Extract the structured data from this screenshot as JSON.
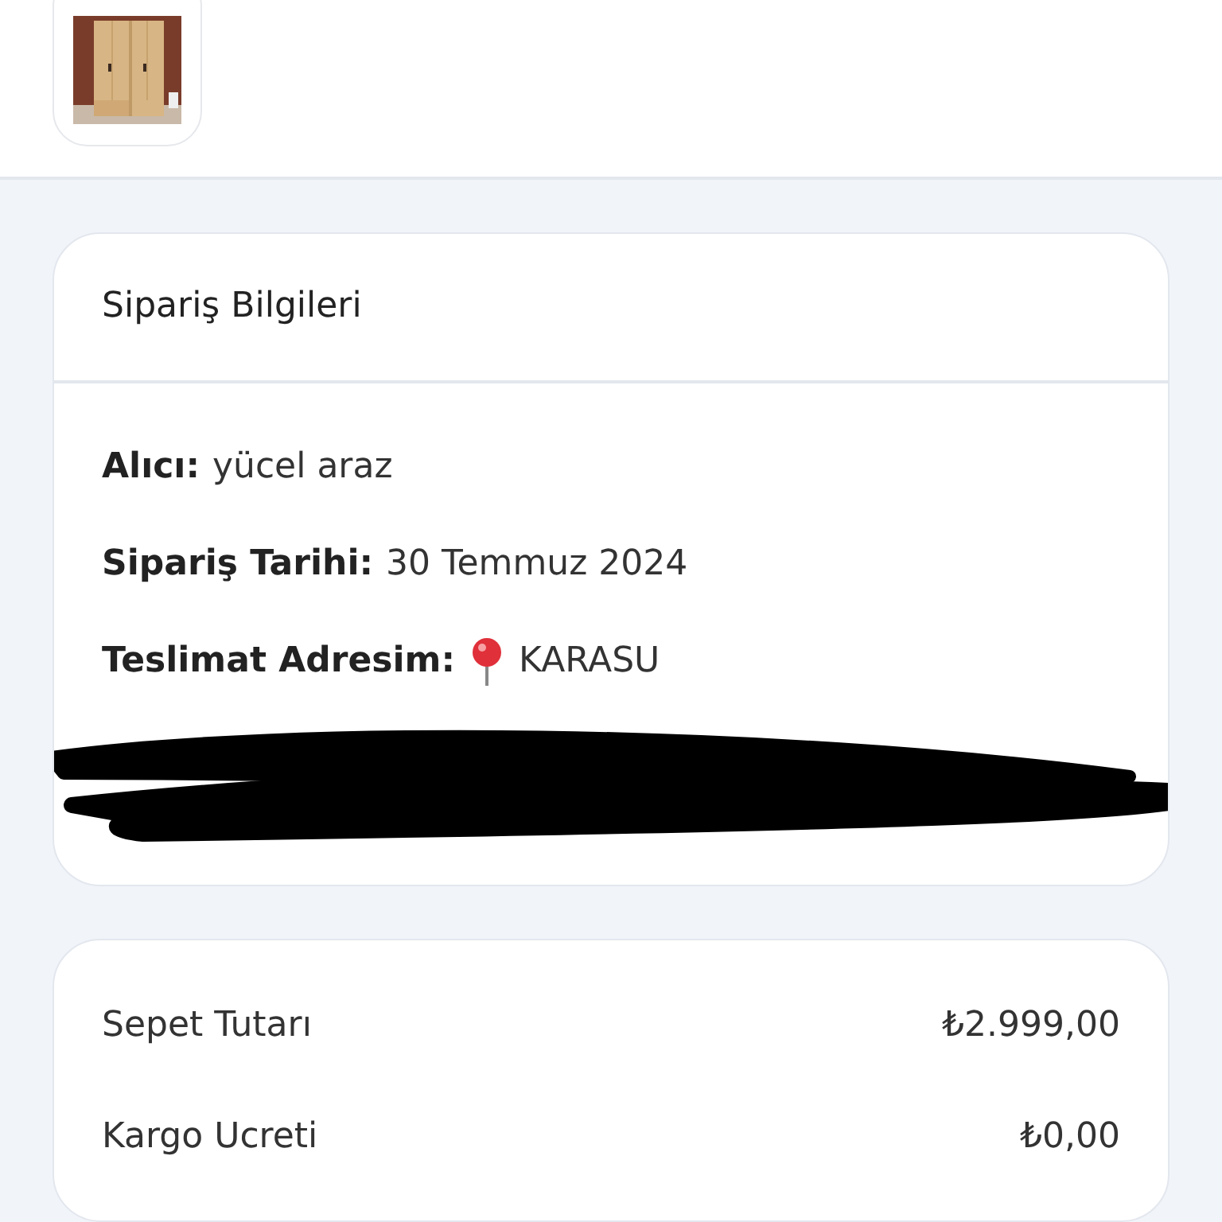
{
  "order_info": {
    "title": "Sipariş Bilgileri",
    "fields": [
      {
        "kind": "text",
        "label": "Alıcı:",
        "value": "yücel araz"
      },
      {
        "kind": "text",
        "label": "Sipariş Tarihi:",
        "value": "30 Temmuz 2024"
      },
      {
        "kind": "location",
        "label": "Teslimat Adresim:",
        "value": "KARASU"
      }
    ],
    "address_redacted": true
  },
  "summary": [
    {
      "label": "Sepet Tutarı",
      "value": "₺2.999,00"
    },
    {
      "label": "Kargo Ucreti",
      "value": "₺0,00"
    }
  ]
}
